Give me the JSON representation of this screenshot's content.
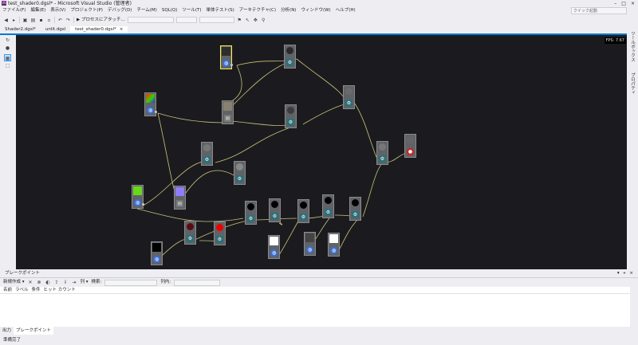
{
  "window": {
    "title": "test_shader0.dgsl* - Microsoft Visual Studio (管理者)",
    "quick_launch_placeholder": "クイック起動",
    "controls": [
      "–",
      "□",
      "×"
    ]
  },
  "menu": [
    "ファイル(F)",
    "編集(E)",
    "表示(V)",
    "プロジェクト(P)",
    "デバッグ(D)",
    "チーム(M)",
    "SQL(Q)",
    "ツール(T)",
    "単体テスト(S)",
    "アーキテクチャ(C)",
    "分析(N)",
    "ウィンドウ(W)",
    "ヘルプ(H)"
  ],
  "toolbar": {
    "attach_label": "▶ プロセスにアタッチ...",
    "combo1": "",
    "combo2": "",
    "combo3": ""
  },
  "tabs": [
    {
      "label": "Shader2.dgsl*",
      "active": false
    },
    {
      "label": "unlit.dgsl",
      "active": false
    },
    {
      "label": "test_shader0.dgsl*",
      "active": true
    }
  ],
  "canvas": {
    "fps": "FPS: 7.67"
  },
  "right_panels": [
    "ツールボックス",
    "プロパティ"
  ],
  "breakpoints": {
    "title": "ブレークポイント",
    "header_buttons": [
      "▾",
      "ᚐ",
      "×"
    ],
    "new_label": "新規作成 ▾",
    "columns_label": "列 ▾",
    "search_label": "検索:",
    "in_column_label": "列内:",
    "columns": [
      "名前",
      "ラベル",
      "条件",
      "ヒット カウント"
    ]
  },
  "bottom_tabs": [
    {
      "label": "出力",
      "active": false
    },
    {
      "label": "ブレークポイント",
      "active": true
    }
  ],
  "status": {
    "text": "準備完了"
  },
  "nodes": [
    {
      "id": "n-selected-sphere",
      "swatch": "ball",
      "color": "#2d2d2d",
      "icon": "blue",
      "selected": true
    },
    {
      "id": "n-top-gear",
      "swatch": "ball",
      "color": "#2a2a2a",
      "icon": "gear"
    },
    {
      "id": "n-gradient-tex",
      "swatch": "gradient",
      "color": "#ff0000",
      "icon": "blue"
    },
    {
      "id": "n-noise-tex",
      "swatch": "noise",
      "color": "#8a8070",
      "icon": "file"
    },
    {
      "id": "n-mid-gear",
      "swatch": "ball",
      "color": "#3c3c3c",
      "icon": "gear"
    },
    {
      "id": "n-right-gear",
      "swatch": "ball",
      "color": "#6a6a6a",
      "icon": "gear"
    },
    {
      "id": "n-gear-a",
      "swatch": "ball",
      "color": "#777777",
      "icon": "gear"
    },
    {
      "id": "n-gear-b",
      "swatch": "ball",
      "color": "#888888",
      "icon": "gear"
    },
    {
      "id": "n-final-gear",
      "swatch": "ball",
      "color": "#777777",
      "icon": "gear"
    },
    {
      "id": "n-output",
      "swatch": "ball",
      "color": "#666666",
      "icon": "red"
    },
    {
      "id": "n-green",
      "swatch": "square",
      "color": "#66d91a",
      "icon": "blue"
    },
    {
      "id": "n-purple",
      "swatch": "square",
      "color": "#8f7cff",
      "icon": "file"
    },
    {
      "id": "n-black-tex",
      "swatch": "square",
      "color": "#000000",
      "icon": "blue"
    },
    {
      "id": "n-darkred",
      "swatch": "ball",
      "color": "#5a0b12",
      "icon": "gear"
    },
    {
      "id": "n-red",
      "swatch": "ball",
      "color": "#ee0000",
      "icon": "gear"
    },
    {
      "id": "n-black1",
      "swatch": "ball",
      "color": "#000000",
      "icon": "gear"
    },
    {
      "id": "n-black2",
      "swatch": "ball",
      "color": "#000000",
      "icon": "gear"
    },
    {
      "id": "n-black3",
      "swatch": "ball",
      "color": "#000000",
      "icon": "gear"
    },
    {
      "id": "n-black4",
      "swatch": "ball",
      "color": "#000000",
      "icon": "gear"
    },
    {
      "id": "n-black5",
      "swatch": "ball",
      "color": "#000000",
      "icon": "gear"
    },
    {
      "id": "n-white1",
      "swatch": "square",
      "color": "#ffffff",
      "icon": "blue"
    },
    {
      "id": "n-gray-sq",
      "swatch": "square",
      "color": "#444444",
      "icon": "blue"
    },
    {
      "id": "n-white2",
      "swatch": "square",
      "color": "#ffffff",
      "icon": "blue"
    }
  ],
  "colors": {
    "accent": "#007acc",
    "canvas": "#1b1b1f",
    "wire": "#c9c27a",
    "selection": "#fff04a"
  }
}
